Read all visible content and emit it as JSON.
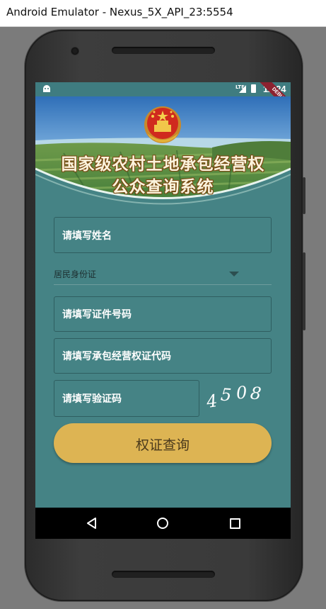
{
  "window": {
    "title": "Android Emulator - Nexus_5X_API_23:5554"
  },
  "statusbar": {
    "network": "LTE",
    "time": "11:24",
    "debug_banner": "DEBUG"
  },
  "banner": {
    "emblem_icon": "national-emblem-icon",
    "title_line1": "国家级农村土地承包经营权",
    "title_line2": "公众查询系统"
  },
  "form": {
    "name_placeholder": "请填写姓名",
    "id_type_selected": "居民身份证",
    "id_number_placeholder": "请填写证件号码",
    "contract_code_placeholder": "请填写承包经营权证代码",
    "captcha_placeholder": "请填写验证码",
    "captcha_value": "4508",
    "captcha_digits": [
      "4",
      "5",
      "0",
      "8"
    ],
    "submit_label": "权证查询"
  },
  "colors": {
    "background": "#458385",
    "button": "#ddb453",
    "statusbar": "#3f7c80"
  },
  "navbar": {
    "back_icon": "back-triangle-icon",
    "home_icon": "home-circle-icon",
    "recent_icon": "recent-apps-square-icon"
  }
}
